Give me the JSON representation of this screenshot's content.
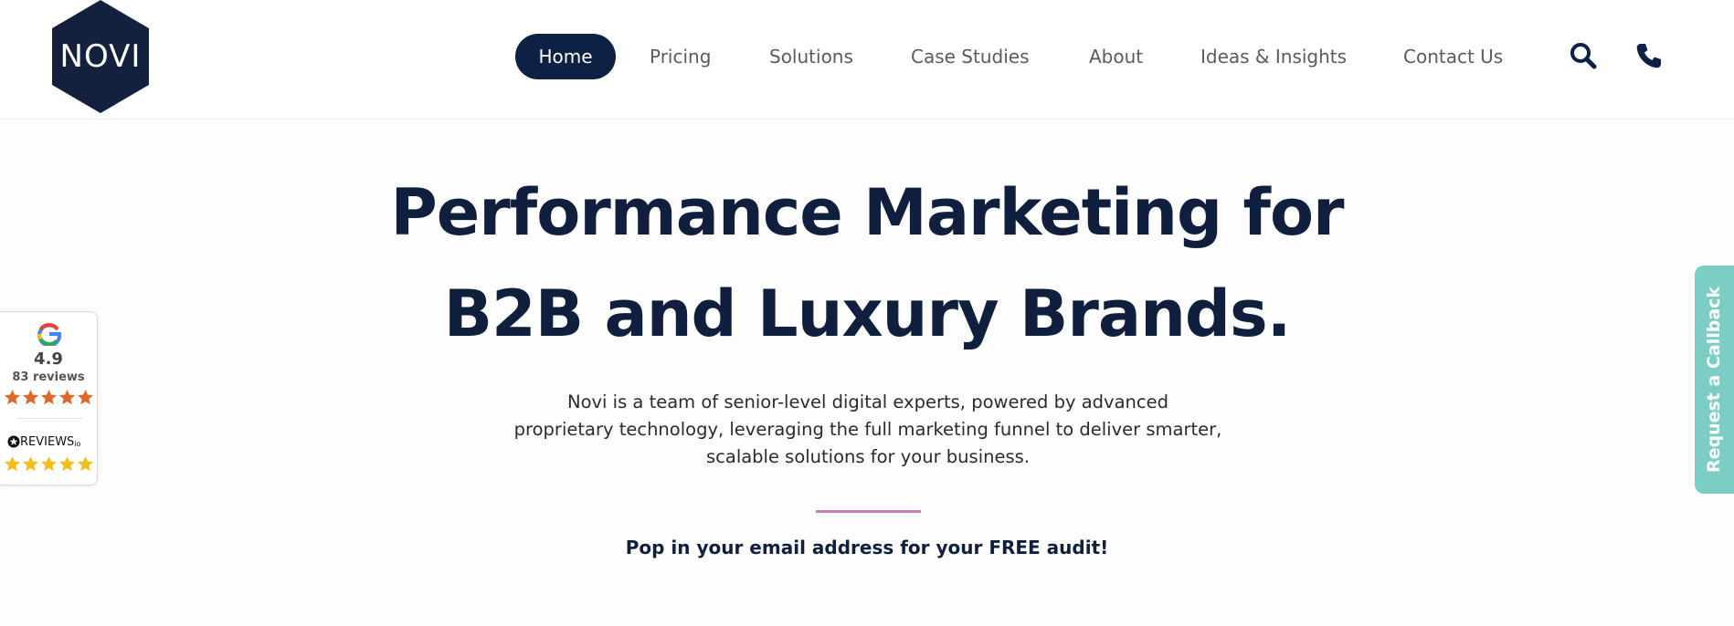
{
  "brand": {
    "logo_text": "NOVI",
    "navy": "#0d2144",
    "accent_teal": "#7ccdc4",
    "accent_pink": "#c77dbf"
  },
  "nav": {
    "items": [
      {
        "label": "Home",
        "active": true
      },
      {
        "label": "Pricing",
        "active": false
      },
      {
        "label": "Solutions",
        "active": false
      },
      {
        "label": "Case Studies",
        "active": false
      },
      {
        "label": "About",
        "active": false
      },
      {
        "label": "Ideas & Insights",
        "active": false
      },
      {
        "label": "Contact Us",
        "active": false
      }
    ],
    "icons": [
      "search-icon",
      "phone-icon"
    ]
  },
  "hero": {
    "title_line1": "Performance Marketing for",
    "title_line2": "B2B and Luxury Brands.",
    "subtitle_line1": "Novi is a team of senior-level digital experts, powered by advanced",
    "subtitle_line2": "proprietary technology, leveraging the full marketing funnel to deliver smarter,",
    "subtitle_line3": "scalable solutions for your business.",
    "cta_text": "Pop in your email address for your FREE audit!"
  },
  "reviews_widget": {
    "google_rating": "4.9",
    "google_count": "83 reviews",
    "google_stars": 5,
    "google_star_color": "#e0682a",
    "reviewsio_label": "REVIEWS",
    "reviewsio_suffix": "io",
    "reviewsio_stars": 5,
    "reviewsio_star_color": "#f6be1b"
  },
  "callback": {
    "label": "Request a Callback"
  }
}
